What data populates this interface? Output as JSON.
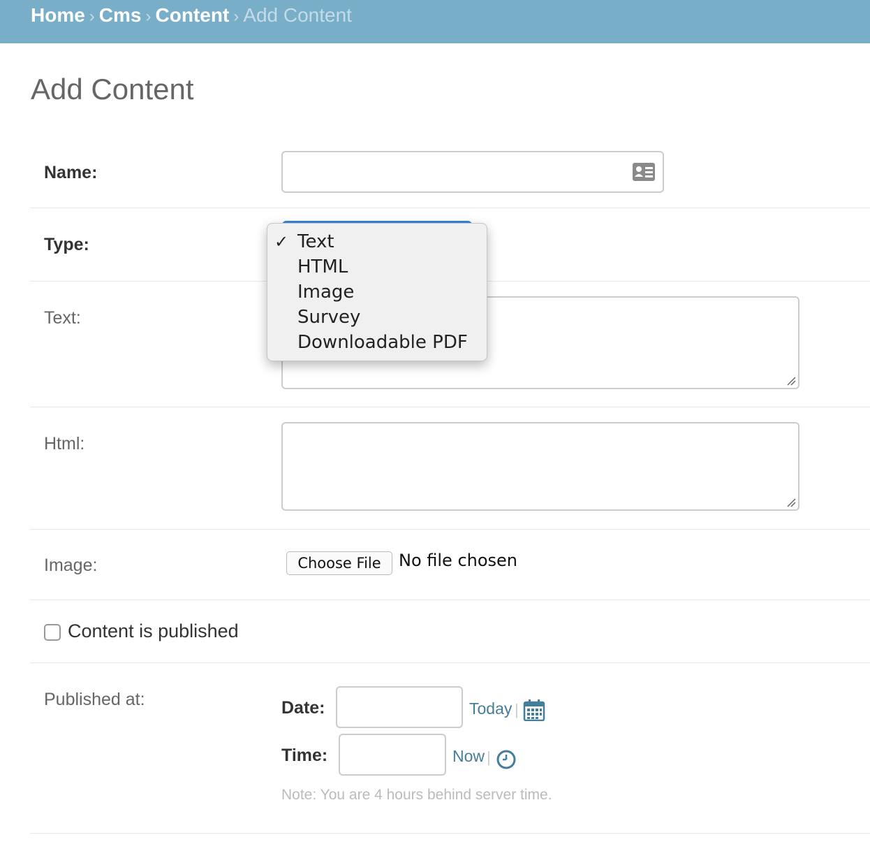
{
  "breadcrumbs": {
    "home": "Home",
    "app": "Cms",
    "model": "Content",
    "current": "Add Content",
    "separator": "›"
  },
  "page": {
    "title": "Add Content"
  },
  "form": {
    "name_label": "Name:",
    "name_value": "",
    "type_label": "Type:",
    "type_selected": "Text",
    "type_options": [
      "Text",
      "HTML",
      "Image",
      "Survey",
      "Downloadable PDF"
    ],
    "type_check": "✓",
    "text_label": "Text:",
    "text_value": "",
    "html_label": "Html:",
    "html_value": "",
    "image_label": "Image:",
    "choose_file_label": "Choose File",
    "file_status": "No file chosen",
    "published_checkbox_label": "Content is published",
    "published_checked": false,
    "published_at_label": "Published at:",
    "date_label": "Date:",
    "date_value": "",
    "today_link": "Today",
    "time_label": "Time:",
    "time_value": "",
    "now_link": "Now",
    "link_separator": "|",
    "timezone_note": "Note: You are 4 hours behind server time."
  },
  "icons": {
    "contact_card": "contact-card-icon",
    "calendar": "calendar-icon",
    "clock": "clock-icon",
    "checkmark": "checkmark-icon"
  },
  "colors": {
    "header_bg": "#79aec8",
    "link": "#447e9b",
    "select_focus": "#3b82d6"
  }
}
